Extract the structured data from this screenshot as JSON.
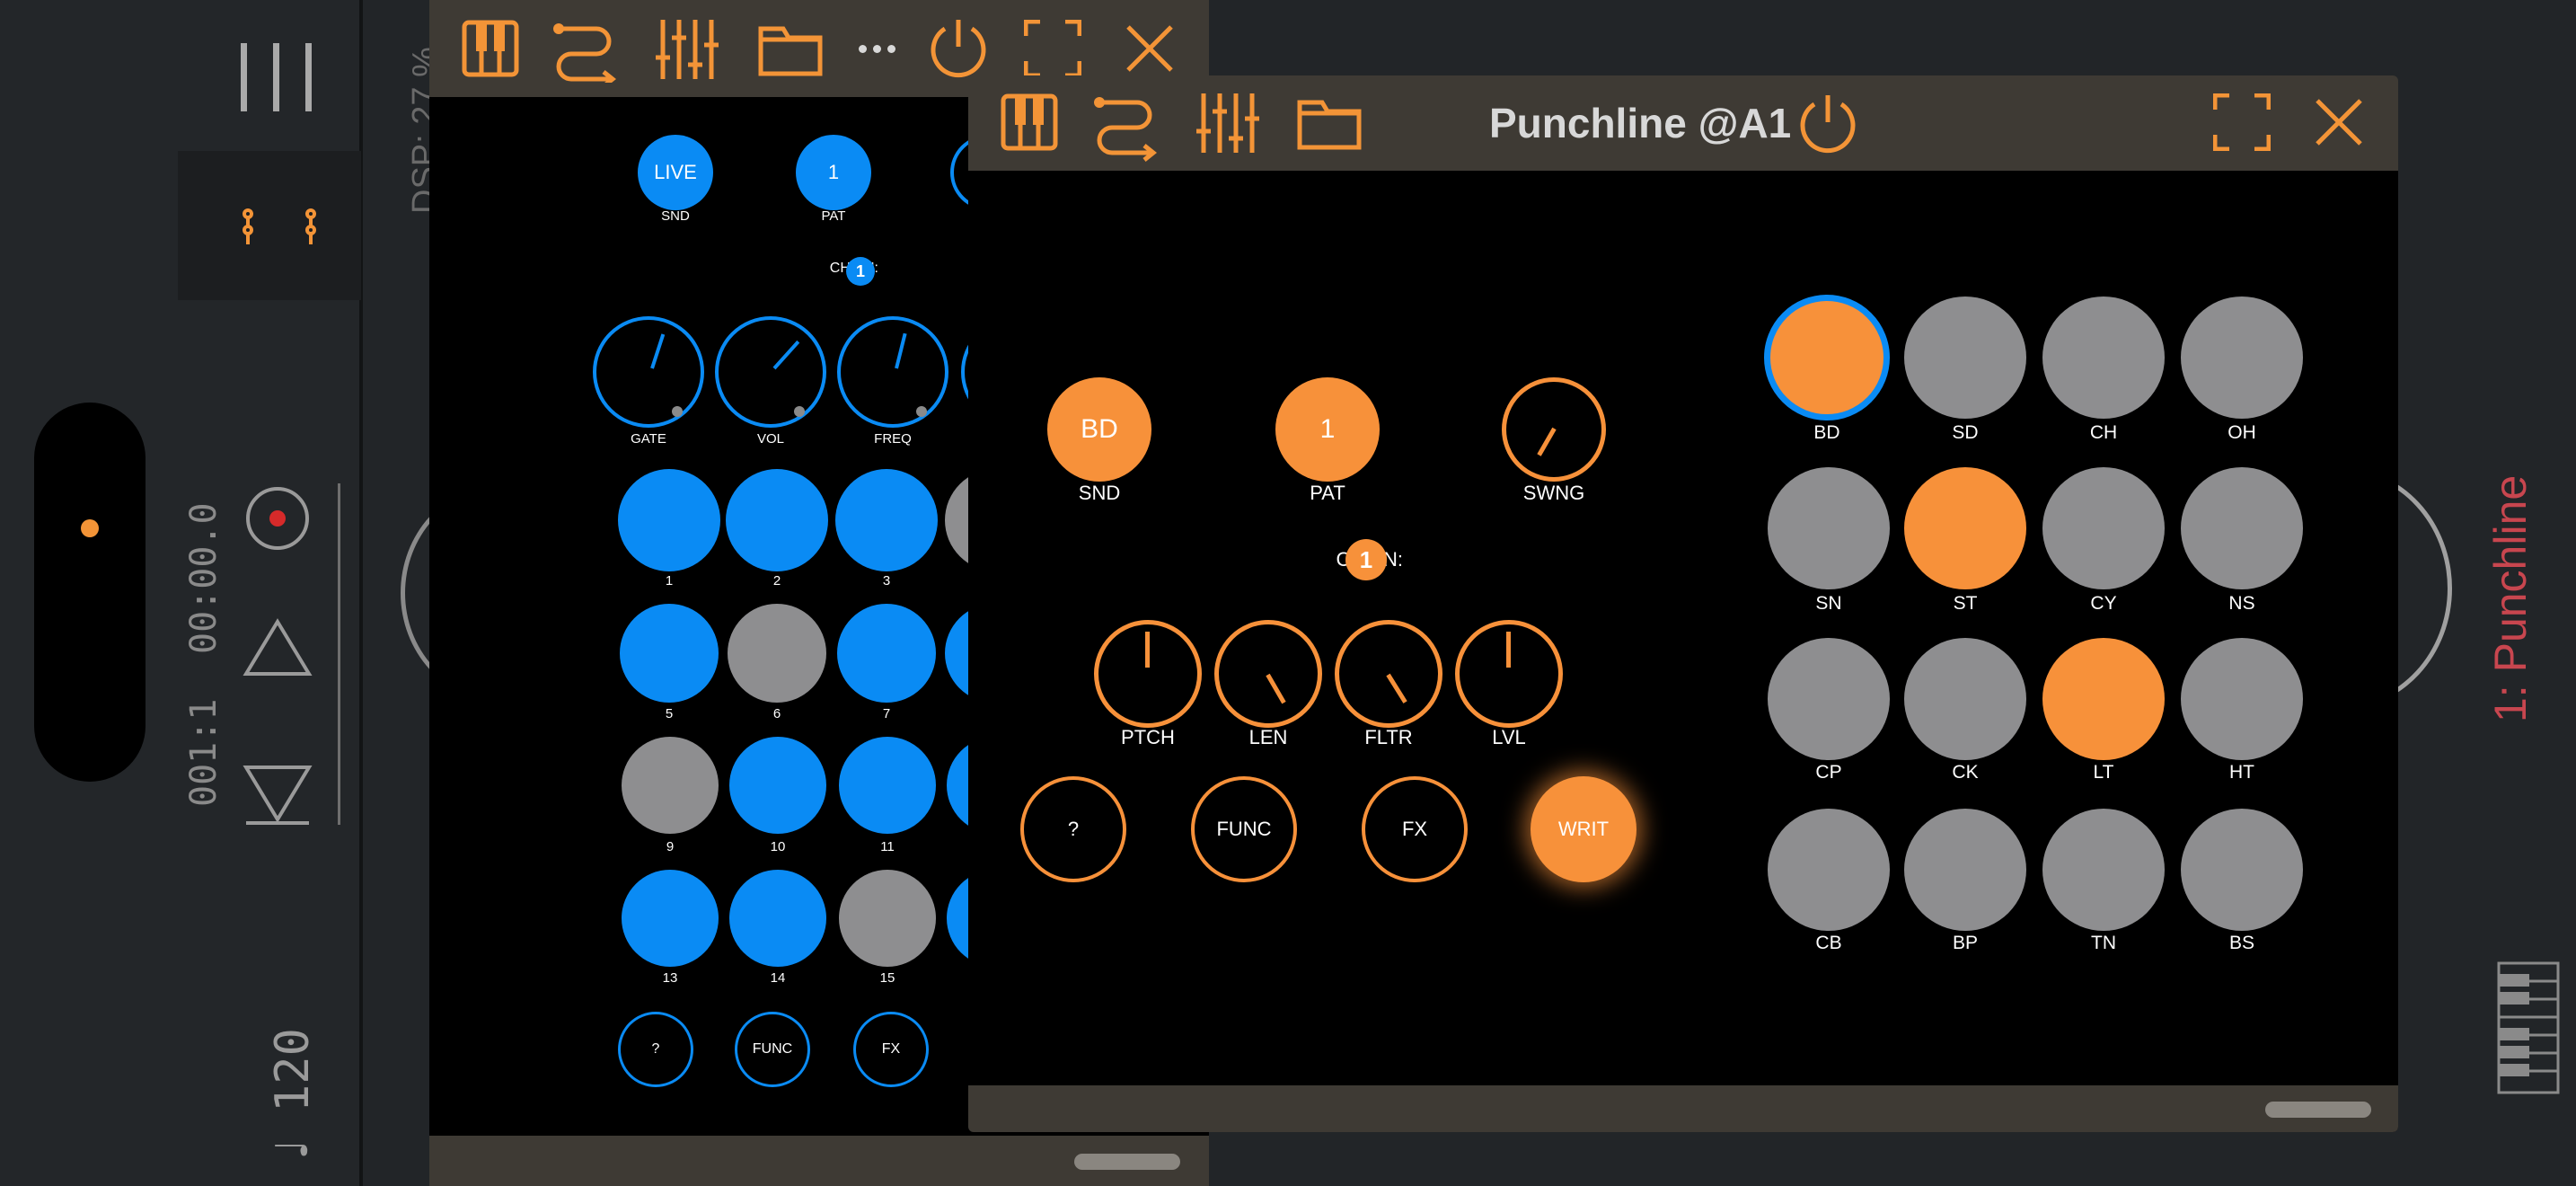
{
  "host": {
    "position": "001:1",
    "time": "00:00.0",
    "tempo_symbol": "♩",
    "tempo": "120",
    "dsp": "DSP: 27 %",
    "channel_label": "1: Punchline"
  },
  "back_window": {
    "snd_value": "LIVE",
    "snd_label": "SND",
    "pat_value": "1",
    "pat_label": "PAT",
    "chain_label": "CHAIN:",
    "chain_value": "1",
    "knobs": [
      "GATE",
      "VOL",
      "FREQ"
    ],
    "steps": [
      "1",
      "2",
      "3",
      "5",
      "6",
      "7",
      "9",
      "10",
      "11",
      "13",
      "14",
      "15"
    ],
    "buttons": [
      "?",
      "FUNC",
      "FX"
    ]
  },
  "front_window": {
    "title": "Punchline @A1",
    "snd_value": "BD",
    "snd_label": "SND",
    "pat_value": "1",
    "pat_label": "PAT",
    "swng_label": "SWNG",
    "chain_label": "CHAIN:",
    "chain_value": "1",
    "knobs": [
      "PTCH",
      "LEN",
      "FLTR",
      "LVL"
    ],
    "buttons": [
      "?",
      "FUNC",
      "FX",
      "WRIT"
    ],
    "pads": [
      "BD",
      "SD",
      "CH",
      "OH",
      "SN",
      "ST",
      "CY",
      "NS",
      "CP",
      "CK",
      "LT",
      "HT",
      "CB",
      "BP",
      "TN",
      "BS"
    ]
  },
  "colors": {
    "accent": "#f7913a",
    "blue": "#0a8bf4",
    "gray": "#8e8e90",
    "record": "#d62a2a",
    "channel": "#c8464f"
  }
}
